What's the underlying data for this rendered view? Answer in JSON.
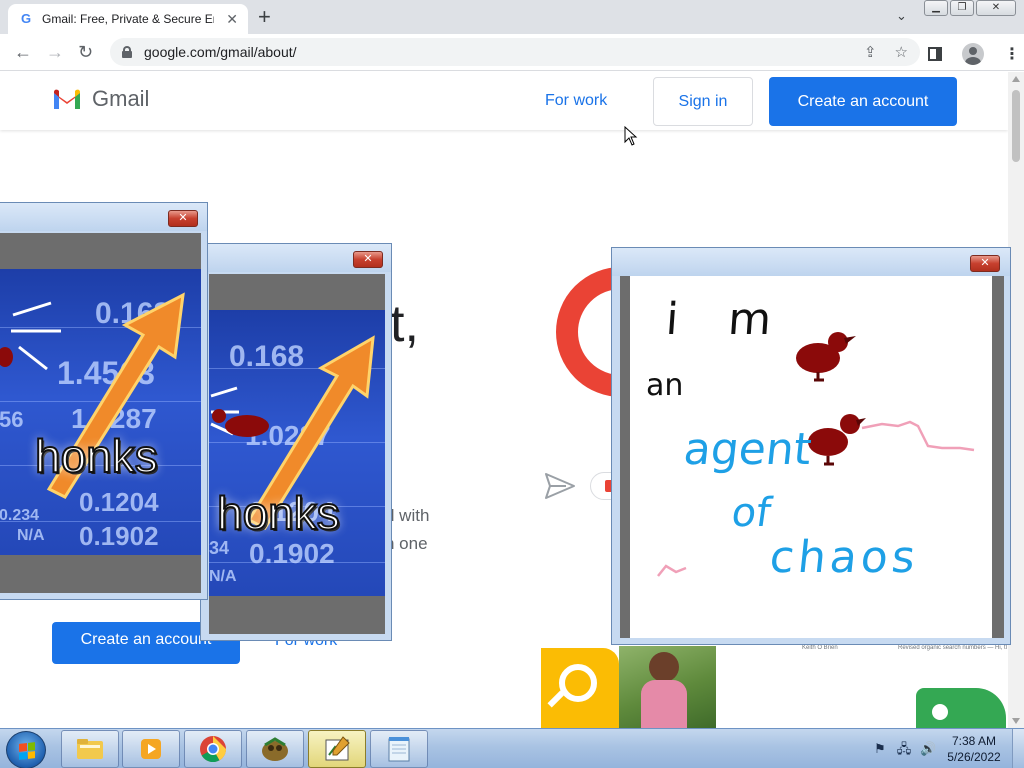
{
  "browser": {
    "tab": {
      "favicon": "G",
      "title": "Gmail: Free, Private & Secure Email",
      "close_glyph": "✕"
    },
    "new_tab_glyph": "+",
    "tab_search_glyph": "⌄",
    "window_buttons": {
      "minimize": "▁",
      "restore": "❐",
      "close": "✕"
    },
    "nav": {
      "back": "←",
      "forward": "→",
      "reload": "↻"
    },
    "url": "google.com/gmail/about/",
    "omnibox_icons": {
      "share": "⇪",
      "bookmark": "☆"
    },
    "menu_glyph": "⋮"
  },
  "gmail": {
    "logo_text": "Gmail",
    "header": {
      "for_work": "For work",
      "sign_in": "Sign in",
      "create_account": "Create an account"
    },
    "hero": {
      "heading_fragment": "t,",
      "body_fragment_1": "d with",
      "body_fragment_2": "n one",
      "create_account": "Create an account",
      "for_work": "For work"
    },
    "mockup_strip": {
      "sender": "Keith O Brien",
      "snippet": "Revised organic search numbers — Hi, tl"
    }
  },
  "popups": {
    "close_glyph": "✕",
    "meme_numbers": [
      "0.168",
      "1.4563",
      "1.0287",
      "0.1204",
      "0.1902",
      "0.234",
      "N/A",
      "56",
      "34"
    ],
    "meme_caption": "honks"
  },
  "drawing": {
    "lines": [
      "i m",
      "an",
      "agent",
      "of",
      "chaos"
    ]
  },
  "taskbar": {
    "items": [
      "explorer",
      "media-player",
      "chrome",
      "game",
      "paint-editor",
      "notepad"
    ],
    "clock_time": "7:38 AM",
    "clock_date": "5/26/2022"
  },
  "colors": {
    "chrome_frame": "#dee1e6",
    "gmail_blue": "#1a73e8",
    "gmail_red": "#ea4335",
    "drawing_blue": "#1ea0e6",
    "drawing_pink": "#f0a0b8",
    "goose_red": "#8b0a0a"
  }
}
